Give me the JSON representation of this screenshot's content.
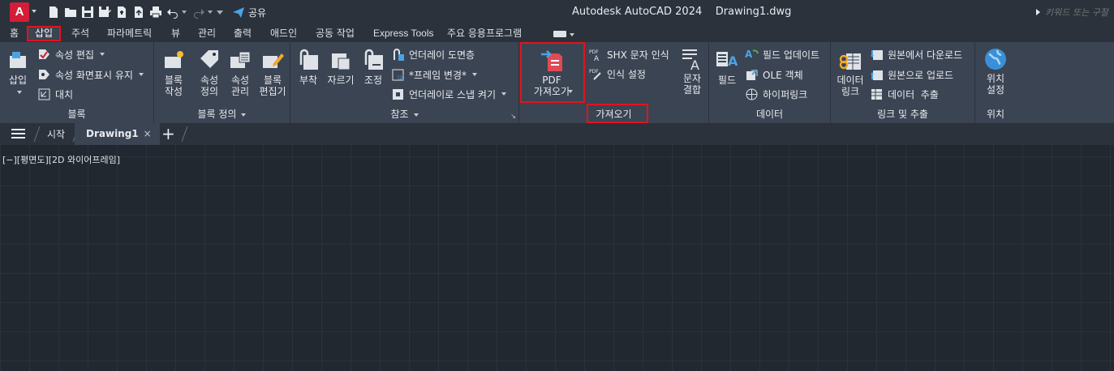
{
  "app": {
    "logo_letter": "A",
    "title": "Autodesk AutoCAD 2024    Drawing1.dwg",
    "share_label": "공유",
    "search_placeholder": "키워드 또는 구절"
  },
  "tabs": [
    {
      "label": "홈"
    },
    {
      "label": "삽입",
      "active": true
    },
    {
      "label": "주석"
    },
    {
      "label": "파라메트릭"
    },
    {
      "label": "뷰"
    },
    {
      "label": "관리"
    },
    {
      "label": "출력"
    },
    {
      "label": "애드인"
    },
    {
      "label": "공동 작업"
    },
    {
      "label": "Express Tools"
    },
    {
      "label": "주요 응용프로그램"
    }
  ],
  "ribbon": {
    "block": {
      "title": "블록",
      "insert": "삽입",
      "edit_attributes": "속성 편집",
      "attribute_display": "속성 화면표시 유지",
      "replace": "대치"
    },
    "block_definition": {
      "title": "블록 정의",
      "create_block": "블록\n작성",
      "define_attributes": "속성\n정의",
      "manage_attributes": "속성\n관리",
      "block_editor": "블록\n편집기"
    },
    "reference": {
      "title": "참조",
      "attach": "부착",
      "clip": "자르기",
      "adjust": "조정",
      "underlay_layers": "언더레이 도면층",
      "frames": "*프레임 변경*",
      "underlay_snap": "언더레이로 스냅 켜기"
    },
    "import": {
      "title": "가져오기",
      "pdf_import": "PDF\n가져오기",
      "shx_recognition": "SHX 문자 인식",
      "recognition_settings": "인식 설정",
      "combine_text": "문자\n결합"
    },
    "data": {
      "title": "데이터",
      "field": "필드",
      "update_fields": "필드 업데이트",
      "ole_object": "OLE 객체",
      "hyperlink": "하이퍼링크"
    },
    "linking": {
      "title": "링크 및 추출",
      "data_link": "데이터\n링크",
      "download_from_source": "원본에서 다운로드",
      "upload_to_source": "원본으로 업로드",
      "extract_data": "데이터  추출"
    },
    "location": {
      "title": "위치",
      "set_location": "위치\n설정"
    }
  },
  "doctabs": {
    "start": "시작",
    "drawing": "Drawing1",
    "close": "×",
    "new": "+"
  },
  "viewport": {
    "label": "[−][평면도][2D 와이어프레임]"
  },
  "colors": {
    "accent_red": "#e1141b",
    "ribbon_bg": "#3b4453",
    "canvas_bg": "#212830"
  }
}
